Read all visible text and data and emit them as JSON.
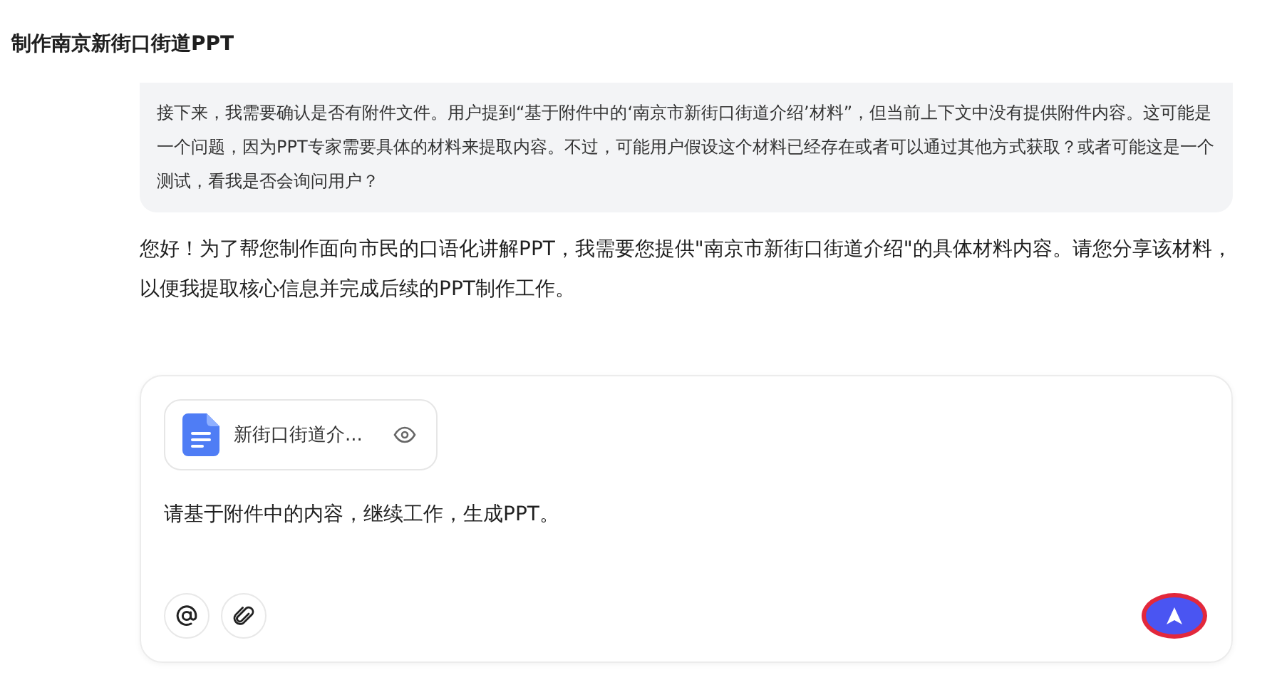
{
  "header": {
    "title": "制作南京新街口街道PPT"
  },
  "thinking": {
    "text": "接下来，我需要确认是否有附件文件。用户提到“基于附件中的‘南京市新街口街道介绍’材料”，但当前上下文中没有提供附件内容。这可能是一个问题，因为PPT专家需要具体的材料来提取内容。不过，可能用户假设这个材料已经存在或者可以通过其他方式获取？或者可能这是一个测试，看我是否会询问用户？"
  },
  "reply": {
    "text": "您好！为了帮您制作面向市民的口语化讲解PPT，我需要您提供\"南京市新街口街道介绍\"的具体材料内容。请您分享该材料，以便我提取核心信息并完成后续的PPT制作工作。"
  },
  "composer": {
    "attachment": {
      "name": "新街口街道介..."
    },
    "message": "请基于附件中的内容，继续工作，生成PPT。",
    "tools": [
      {
        "kind": "mention"
      },
      {
        "kind": "attach"
      }
    ],
    "send": {
      "disabled": false
    }
  }
}
